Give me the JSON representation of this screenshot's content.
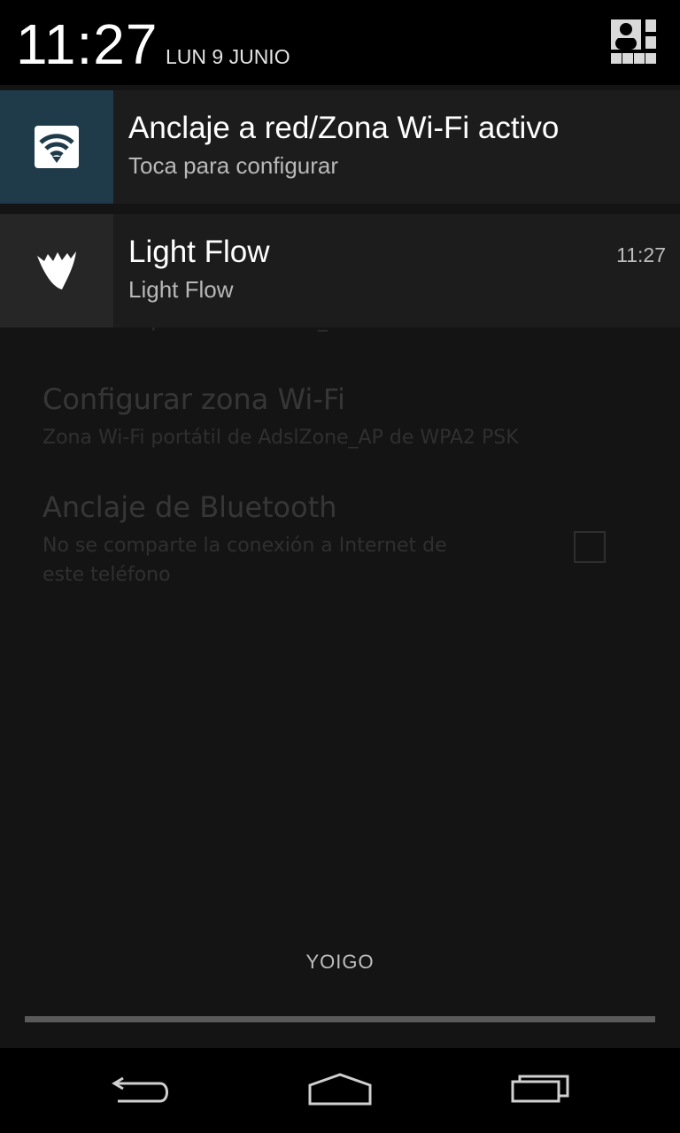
{
  "status": {
    "time": "11:27",
    "date": "LUN 9 JUNIO",
    "quick_settings_icon": "quick-settings-icon"
  },
  "background": {
    "items": [
      {
        "title": "",
        "subtitle": "Zona Wi-Fi portátil AdslZone_AP activa"
      },
      {
        "title": "Configurar zona Wi-Fi",
        "subtitle": "Zona Wi-Fi portátil de AdslZone_AP de WPA2 PSK"
      },
      {
        "title": "Anclaje de Bluetooth",
        "subtitle": "No se comparte la conexión a Internet de",
        "subtitle2": "este teléfono"
      }
    ]
  },
  "notifications": [
    {
      "icon": "wifi-hotspot-icon",
      "title": "Anclaje a red/Zona Wi-Fi activo",
      "text": "Toca para configurar",
      "time": "",
      "icon_bg": "#1f3a48"
    },
    {
      "icon": "light-flow-icon",
      "title": "Light Flow",
      "text": "Light Flow",
      "time": "11:27",
      "icon_bg": "#262626"
    }
  ],
  "carrier": "YOIGO",
  "navbar": {
    "back_icon": "back-icon",
    "home_icon": "home-icon",
    "recents_icon": "recents-icon"
  }
}
